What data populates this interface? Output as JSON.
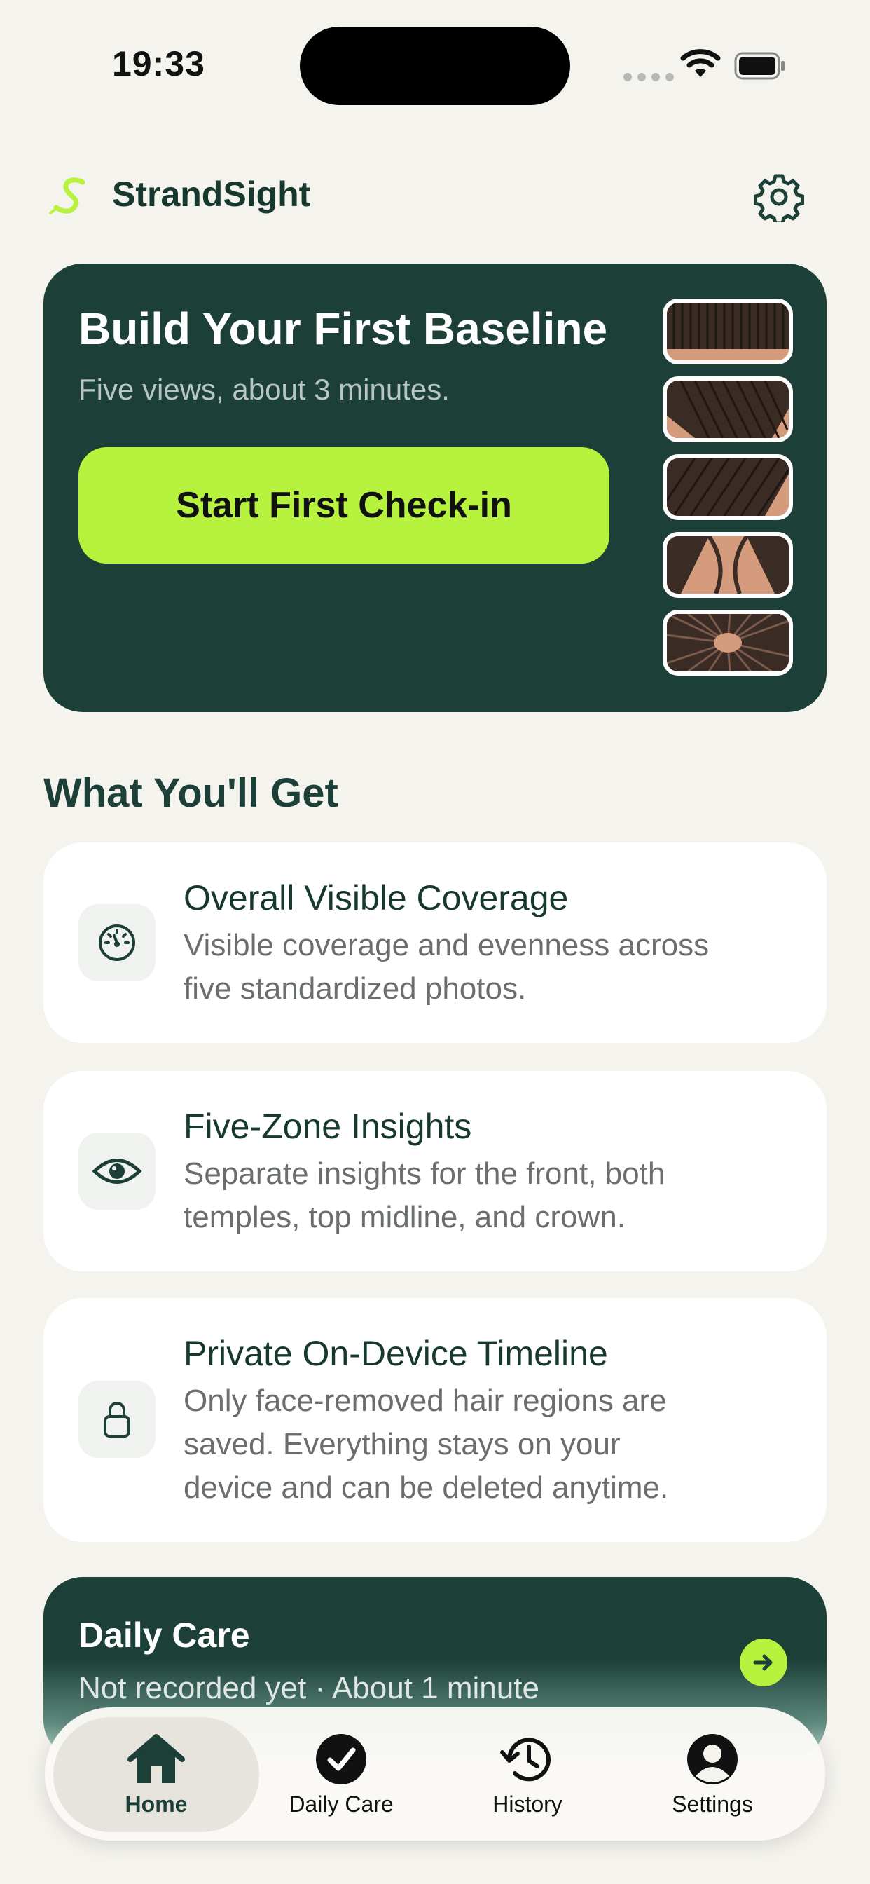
{
  "status_bar": {
    "time": "19:33"
  },
  "header": {
    "app_name": "StrandSight",
    "settings_icon": "gear-icon"
  },
  "hero": {
    "title": "Build Your First Baseline",
    "subtitle": "Five views, about 3 minutes.",
    "button_label": "Start First Check-in",
    "views": [
      "front-view",
      "left-temple-view",
      "right-temple-view",
      "top-midline-view",
      "crown-view"
    ]
  },
  "section_title": "What You'll Get",
  "features": [
    {
      "icon": "gauge-icon",
      "title": "Overall Visible Coverage",
      "desc_1": "Visible coverage and evenness across",
      "desc_2": "five standardized photos."
    },
    {
      "icon": "eye-icon",
      "title": "Five-Zone Insights",
      "desc_1": "Separate insights for the front, both",
      "desc_2": "temples, top midline, and crown."
    },
    {
      "icon": "lock-icon",
      "title": "Private On-Device Timeline",
      "desc_1": "Only face-removed hair regions are",
      "desc_2": "saved. Everything stays on your",
      "desc_3": "device and can be deleted anytime."
    }
  ],
  "daily_care": {
    "title": "Daily Care",
    "subtitle": "Not recorded yet · About 1 minute"
  },
  "tabs": [
    {
      "label": "Home",
      "icon": "house-icon",
      "active": true
    },
    {
      "label": "Daily Care",
      "icon": "checkmark-circle-icon",
      "active": false
    },
    {
      "label": "History",
      "icon": "history-clock-icon",
      "active": false
    },
    {
      "label": "Settings",
      "icon": "person-circle-icon",
      "active": false
    }
  ],
  "colors": {
    "background": "#f4f3ee",
    "primary_dark": "#1c3f38",
    "accent_lime": "#b6f23e",
    "card": "#ffffff"
  }
}
